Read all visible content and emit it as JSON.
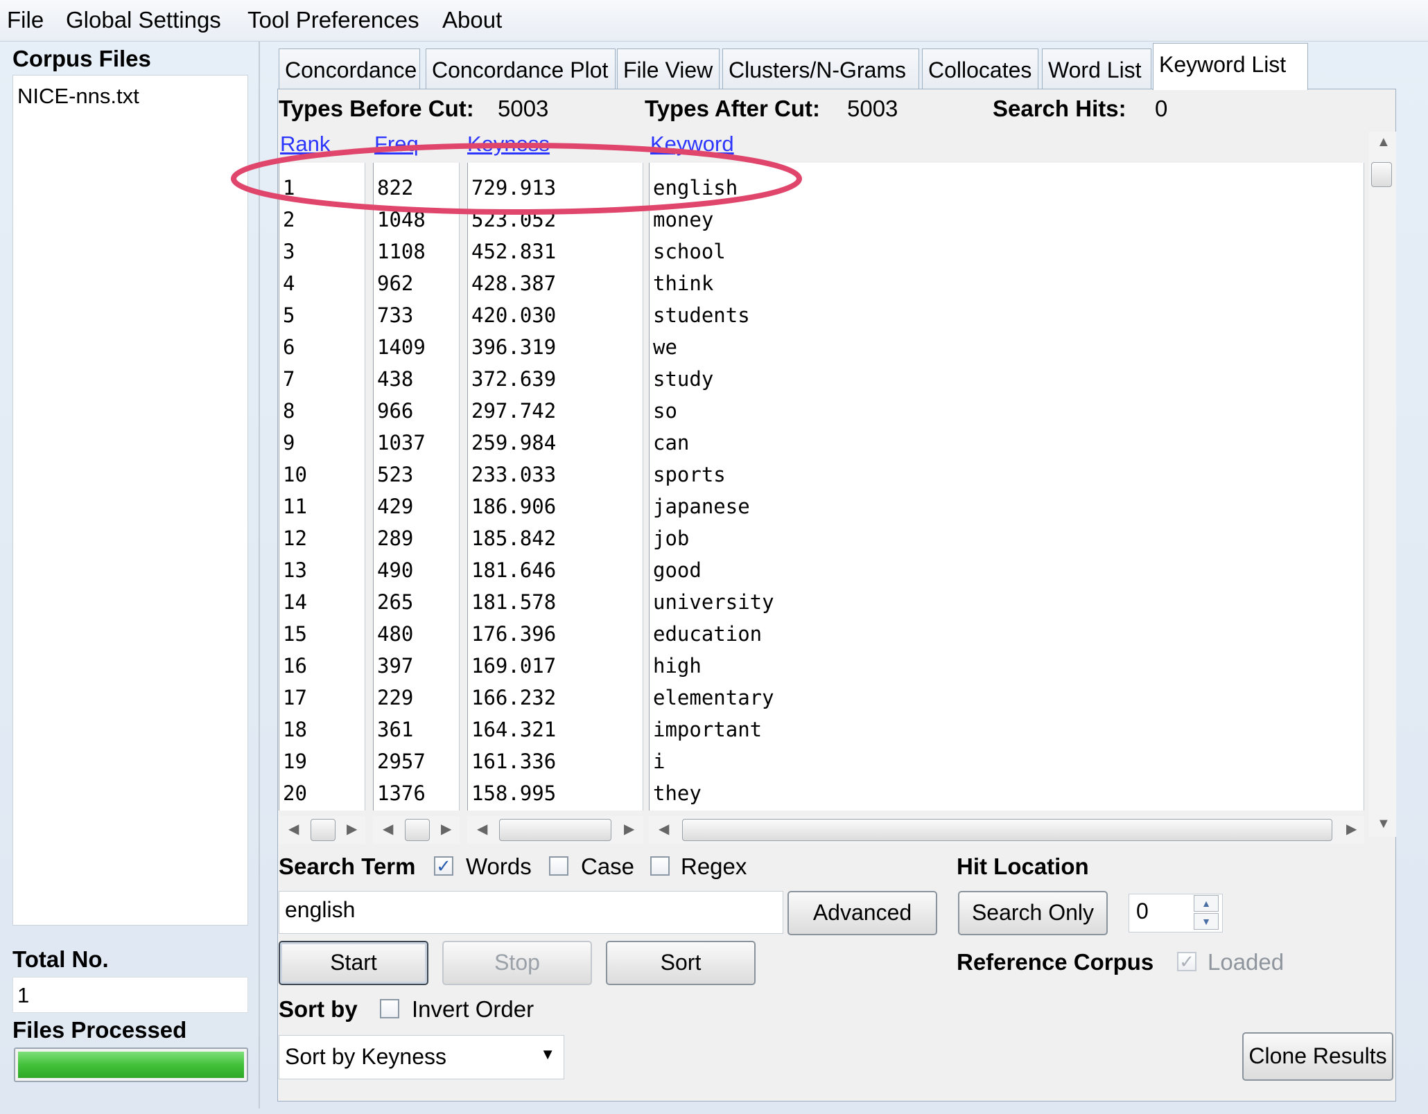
{
  "menu": [
    "File",
    "Global Settings",
    "Tool Preferences",
    "About"
  ],
  "left": {
    "corpus_files_label": "Corpus Files",
    "files": [
      "NICE-nns.txt"
    ],
    "total_label": "Total No.",
    "total_value": "1",
    "processed_label": "Files Processed",
    "progress_fraction": 1.0
  },
  "tabs": [
    "Concordance",
    "Concordance Plot",
    "File View",
    "Clusters/N-Grams",
    "Collocates",
    "Word List",
    "Keyword List"
  ],
  "active_tab": "Keyword List",
  "stats": {
    "types_before_label": "Types Before Cut:",
    "types_before_value": "5003",
    "types_after_label": "Types After Cut:",
    "types_after_value": "5003",
    "search_hits_label": "Search Hits:",
    "search_hits_value": "0"
  },
  "table": {
    "headers": [
      "Rank",
      "Freq",
      "Keyness",
      "Keyword"
    ],
    "rows": [
      [
        "1",
        "822",
        "729.913",
        "english"
      ],
      [
        "2",
        "1048",
        "523.052",
        "money"
      ],
      [
        "3",
        "1108",
        "452.831",
        "school"
      ],
      [
        "4",
        "962",
        "428.387",
        "think"
      ],
      [
        "5",
        "733",
        "420.030",
        "students"
      ],
      [
        "6",
        "1409",
        "396.319",
        "we"
      ],
      [
        "7",
        "438",
        "372.639",
        "study"
      ],
      [
        "8",
        "966",
        "297.742",
        "so"
      ],
      [
        "9",
        "1037",
        "259.984",
        "can"
      ],
      [
        "10",
        "523",
        "233.033",
        "sports"
      ],
      [
        "11",
        "429",
        "186.906",
        "japanese"
      ],
      [
        "12",
        "289",
        "185.842",
        "job"
      ],
      [
        "13",
        "490",
        "181.646",
        "good"
      ],
      [
        "14",
        "265",
        "181.578",
        "university"
      ],
      [
        "15",
        "480",
        "176.396",
        "education"
      ],
      [
        "16",
        "397",
        "169.017",
        "high"
      ],
      [
        "17",
        "229",
        "166.232",
        "elementary"
      ],
      [
        "18",
        "361",
        "164.321",
        "important"
      ],
      [
        "19",
        "2957",
        "161.336",
        "i"
      ],
      [
        "20",
        "1376",
        "158.995",
        "they"
      ]
    ]
  },
  "search": {
    "label": "Search Term",
    "words_label": "Words",
    "words_checked": true,
    "case_label": "Case",
    "case_checked": false,
    "regex_label": "Regex",
    "regex_checked": false,
    "value": "english",
    "advanced_label": "Advanced"
  },
  "hit_location": {
    "label": "Hit Location",
    "search_only_label": "Search Only",
    "value": "0"
  },
  "buttons": {
    "start": "Start",
    "stop": "Stop",
    "sort": "Sort",
    "clone": "Clone Results"
  },
  "reference": {
    "label": "Reference Corpus",
    "loaded_label": "Loaded",
    "loaded_checked": true
  },
  "sort": {
    "label": "Sort by",
    "invert_label": "Invert Order",
    "invert_checked": false,
    "selected": "Sort by Keyness"
  },
  "colors": {
    "header_link": "#2b35ff",
    "highlight_ellipse": "#e0456c",
    "progress": "#43c13b"
  }
}
